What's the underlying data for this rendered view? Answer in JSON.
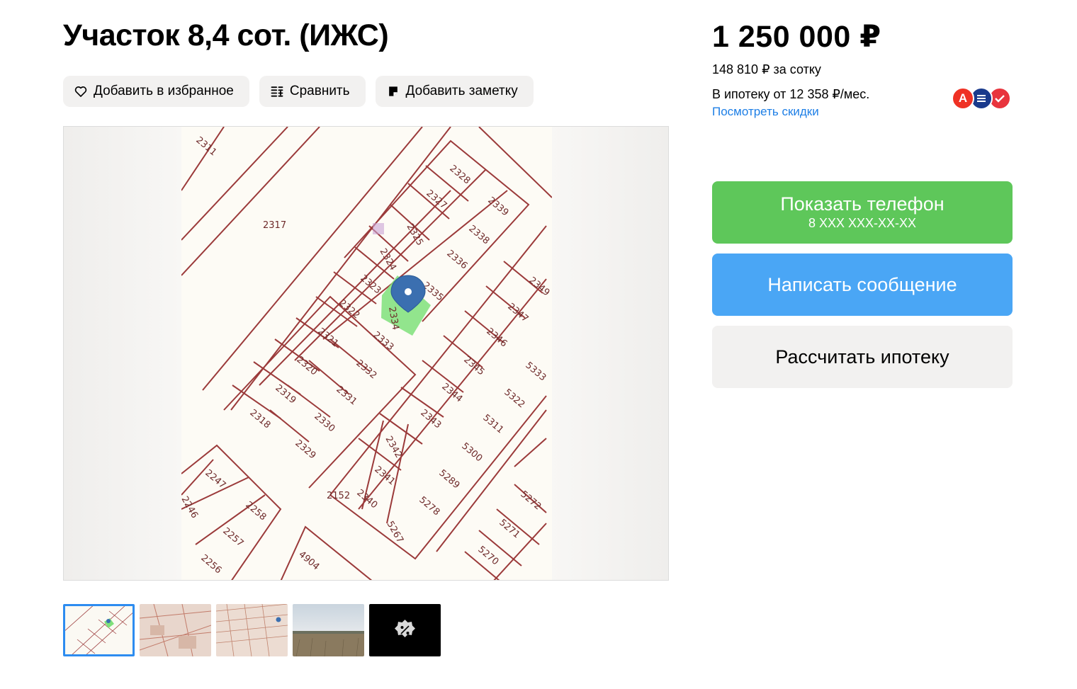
{
  "listing": {
    "title": "Участок 8,4 сот. (ИЖС)"
  },
  "actions": {
    "favorite": "Добавить в избранное",
    "compare": "Сравнить",
    "note": "Добавить заметку"
  },
  "pricing": {
    "price": "1 250 000 ₽",
    "per_sotka": "148 810 ₽ за сотку",
    "mortgage": "В ипотеку от 12 358 ₽/мес.",
    "discounts_link": "Посмотреть скидки"
  },
  "banks": [
    {
      "icon": "alfa-bank-icon",
      "letter": "А",
      "color": "#ef3124"
    },
    {
      "icon": "bank-stack-icon",
      "letter": "",
      "color": "#1a3a8c"
    },
    {
      "icon": "bank-check-icon",
      "letter": "",
      "color": "#e8343d"
    }
  ],
  "buttons": {
    "show_phone": "Показать телефон",
    "phone_masked": "8 XXX XXX-XX-XX",
    "write_message": "Написать сообщение",
    "calc_mortgage": "Рассчитать ипотеку"
  },
  "map": {
    "plot_labels": [
      "2311",
      "2317",
      "2328",
      "2327",
      "2339",
      "2325",
      "2338",
      "2324",
      "2336",
      "2323",
      "2335",
      "2322",
      "2334",
      "2349",
      "2347",
      "2321",
      "2333",
      "2346",
      "2320",
      "2332",
      "2345",
      "5333",
      "2319",
      "2331",
      "2344",
      "5322",
      "2318",
      "2330",
      "2343",
      "5311",
      "2329",
      "2342",
      "5300",
      "2341",
      "5289",
      "2340",
      "5278",
      "2152",
      "5267",
      "2247",
      "2258",
      "2246",
      "2257",
      "2256",
      "4904",
      "5272",
      "5271",
      "5270"
    ],
    "highlighted_plot": "2334",
    "marker": "location-pin-icon"
  },
  "thumbnails": [
    {
      "name": "thumb-plan",
      "active": true
    },
    {
      "name": "thumb-cadastral-map",
      "active": false
    },
    {
      "name": "thumb-area-map",
      "active": false
    },
    {
      "name": "thumb-field-photo",
      "active": false
    },
    {
      "name": "thumb-discount-badge",
      "active": false
    }
  ],
  "colors": {
    "phone_button": "#5ec75a",
    "message_button": "#4aa6f5",
    "link": "#1e7fe6",
    "plot_lines": "#9b3a3a",
    "highlight": "#7fe07a"
  }
}
